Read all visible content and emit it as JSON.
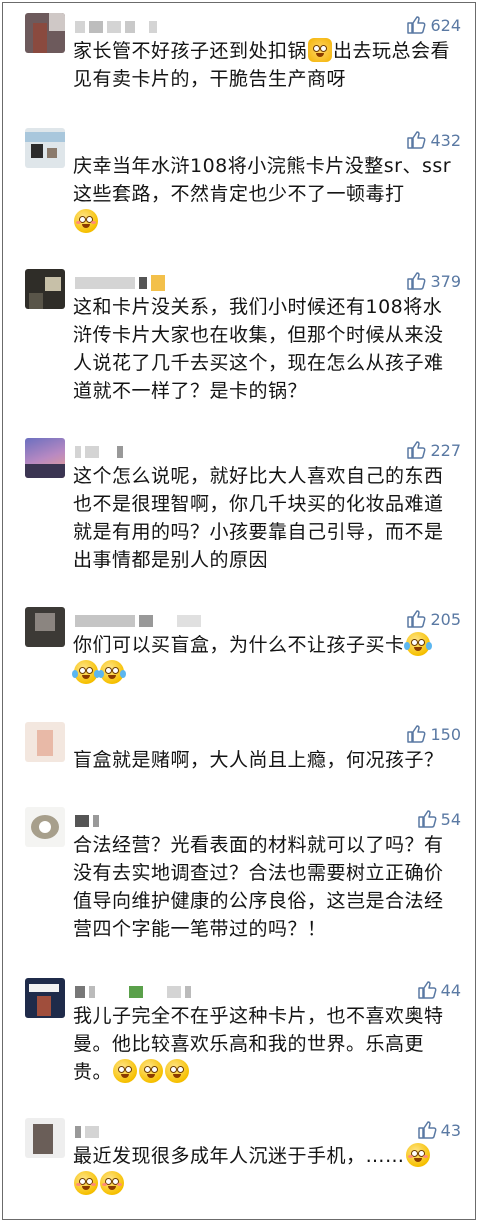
{
  "comments": [
    {
      "likes": "624",
      "text": "家长管不好孩子还到处扣锅",
      "text2": "出去玩总会看见有卖卡片的，干脆告生产商呀",
      "emoji": "cat-face-icon"
    },
    {
      "likes": "432",
      "text": "庆幸当年水浒108将小浣熊卡片没整sr、ssr这些套路，不然肯定也少不了一顿毒打",
      "emoji": "blush-smile-icon"
    },
    {
      "likes": "379",
      "text": "这和卡片没关系，我们小时候还有108将水浒传卡片大家也在收集，但那个时候从来没人说花了几千去买这个，现在怎么从孩子难道就不一样了？是卡的锅？"
    },
    {
      "likes": "227",
      "text": "这个怎么说呢，就好比大人喜欢自己的东西也不是很理智啊，你几千块买的化妆品难道就是有用的吗？小孩要靠自己引导，而不是出事情都是别人的原因"
    },
    {
      "likes": "205",
      "text": "你们可以买盲盒，为什么不让孩子买卡",
      "emoji": "tears-of-joy-icon"
    },
    {
      "likes": "150",
      "text": "盲盒就是赌啊，大人尚且上瘾，何况孩子？"
    },
    {
      "likes": "54",
      "text": "合法经营？光看表面的材料就可以了吗？有没有去实地调查过？合法也需要树立正确价值导向维护健康的公序良俗，这岂是合法经营四个字能一笔带过的吗？！"
    },
    {
      "likes": "44",
      "text": "我儿子完全不在乎这种卡片，也不喜欢奥特曼。他比较喜欢乐高和我的世界。乐高更贵。",
      "emoji": "flushed-face-icon"
    },
    {
      "likes": "43",
      "text": "最近发现很多成年人沉迷于手机，……",
      "emoji": "blush-smile-icon"
    }
  ]
}
